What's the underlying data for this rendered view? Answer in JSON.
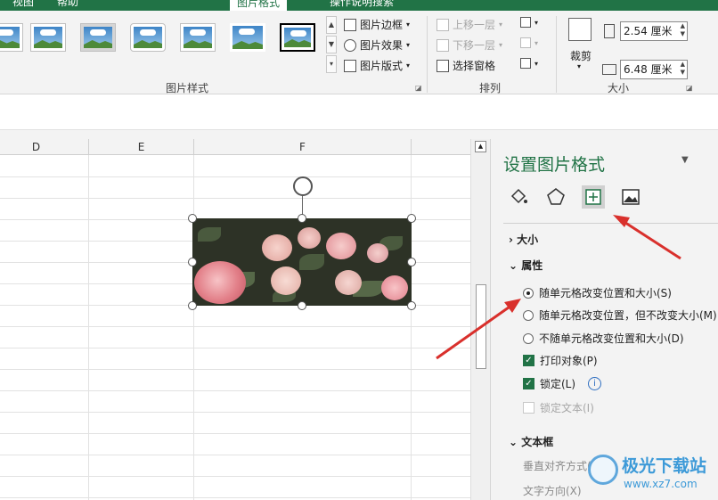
{
  "tabs": [
    {
      "label": "视图"
    },
    {
      "label": "帮助"
    },
    {
      "label": "图片格式"
    },
    {
      "label": "操作说明搜索"
    }
  ],
  "ribbon": {
    "border_label": "图片边框",
    "effects_label": "图片效果",
    "layout_label": "图片版式",
    "group_styles": "图片样式",
    "bring_forward": "上移一层",
    "send_backward": "下移一层",
    "selection_pane": "选择窗格",
    "group_arrange": "排列",
    "crop_label": "裁剪",
    "height_value": "2.54 厘米",
    "width_value": "6.48 厘米",
    "group_size": "大小"
  },
  "sheet": {
    "columns": [
      {
        "label": "D"
      },
      {
        "label": "E"
      },
      {
        "label": "F"
      }
    ]
  },
  "pane": {
    "title": "设置图片格式",
    "size_section": "大小",
    "props_section": "属性",
    "opt1": "随单元格改变位置和大小(S)",
    "opt2": "随单元格改变位置，但不改变大小(M)",
    "opt3": "不随单元格改变位置和大小(D)",
    "print_obj": "打印对象(P)",
    "lock": "锁定(L)",
    "lock_text": "锁定文本(I)",
    "textbox_section": "文本框",
    "valign": "垂直对齐方式(V)",
    "textdir": "文字方向(X)"
  },
  "watermark": {
    "brand": "极光下载站",
    "url": "www.xz7.com"
  },
  "colors": {
    "accent": "#217346",
    "arrow": "#d9302c"
  }
}
